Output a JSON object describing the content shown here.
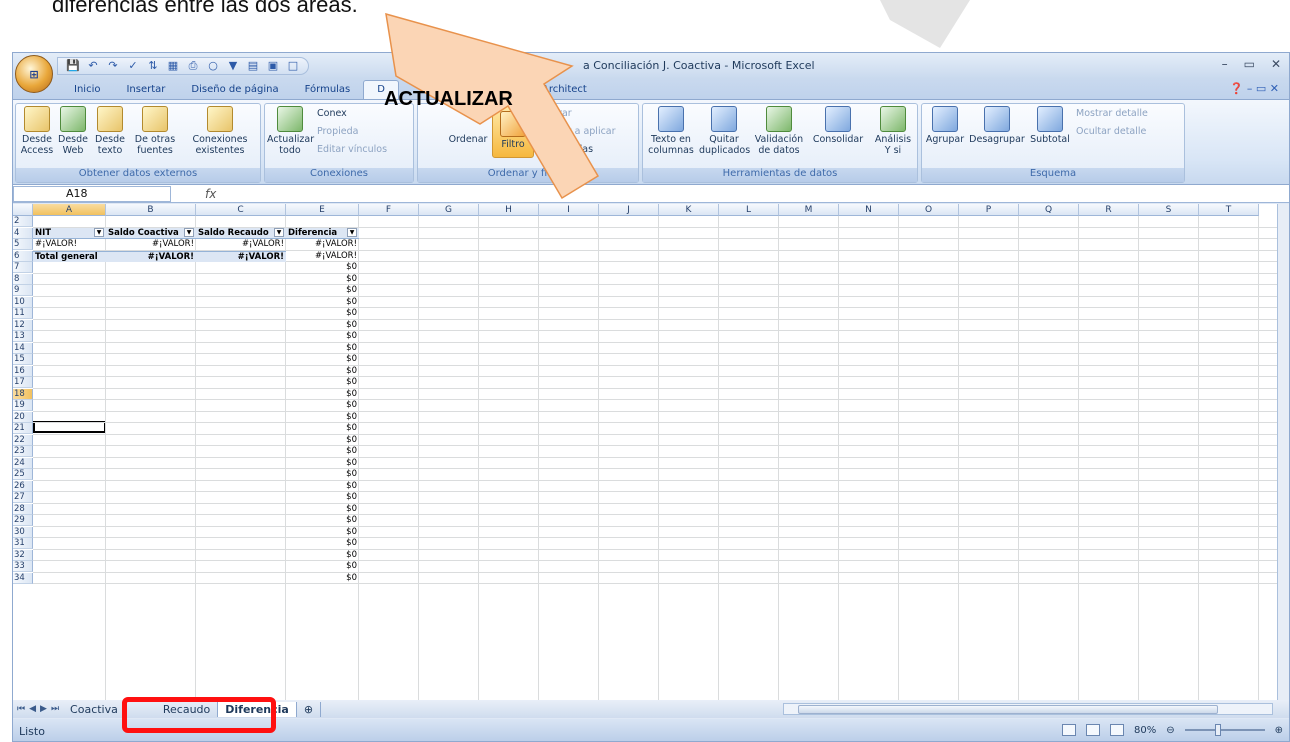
{
  "caption": "diferencias entre las dos áreas.",
  "window": {
    "title": "a Conciliación J. Coactiva - Microsoft Excel",
    "controls": [
      "–",
      "▭",
      "✕"
    ]
  },
  "tabs": [
    "Inicio",
    "Insertar",
    "Diseño de página",
    "Fórmulas",
    "D",
    "Architect"
  ],
  "ribbon": {
    "obtener": {
      "label": "Obtener datos externos",
      "buttons": [
        "Desde Access",
        "Desde Web",
        "Desde texto",
        "De otras fuentes",
        "Conexiones existentes"
      ]
    },
    "conexiones": {
      "label": "Conexiones",
      "actualizar": "Actualizar todo",
      "items": [
        "Conex",
        "Propieda",
        "Editar vínculos"
      ]
    },
    "ordenar": {
      "label": "Ordenar y filtrar",
      "ordenar": "Ordenar",
      "filtro": "Filtro",
      "items": [
        "Borrar",
        "Volver a aplicar",
        "Avanzadas"
      ]
    },
    "herramientas": {
      "label": "Herramientas de datos",
      "buttons": [
        "Texto en columnas",
        "Quitar duplicados",
        "Validación de datos",
        "Consolidar",
        "Análisis Y si"
      ]
    },
    "esquema": {
      "label": "Esquema",
      "buttons": [
        "Agrupar",
        "Desagrupar",
        "Subtotal"
      ],
      "items": [
        "Mostrar detalle",
        "Ocultar detalle"
      ]
    }
  },
  "formula_bar": {
    "namebox": "A18",
    "fx": "fx"
  },
  "columns": [
    "A",
    "B",
    "C",
    "E",
    "F",
    "G",
    "H",
    "I",
    "J",
    "K",
    "L",
    "M",
    "N",
    "O",
    "P",
    "Q",
    "R",
    "S",
    "T"
  ],
  "rows": [
    "2",
    "4",
    "5",
    "6",
    "7",
    "8",
    "9",
    "10",
    "11",
    "12",
    "13",
    "14",
    "15",
    "16",
    "17",
    "18",
    "19",
    "20",
    "21",
    "22",
    "23",
    "24",
    "25",
    "26",
    "27",
    "28",
    "29",
    "30",
    "31",
    "32",
    "33",
    "34"
  ],
  "pivot": {
    "headers": [
      "NIT",
      "Saldo Coactiva",
      "Saldo Recaudo",
      "Diferencia"
    ],
    "row5": [
      "#¡VALOR!",
      "#¡VALOR!",
      "#¡VALOR!",
      "#¡VALOR!"
    ],
    "total": [
      "Total general",
      "#¡VALOR!",
      "#¡VALOR!",
      "#¡VALOR!"
    ]
  },
  "zero_value": "$0",
  "sheets": [
    "Coactiva",
    "Recaudo",
    "Diferencia"
  ],
  "status": {
    "ready": "Listo",
    "zoom": "80%"
  },
  "callout": {
    "text": "ACTUALIZAR"
  }
}
